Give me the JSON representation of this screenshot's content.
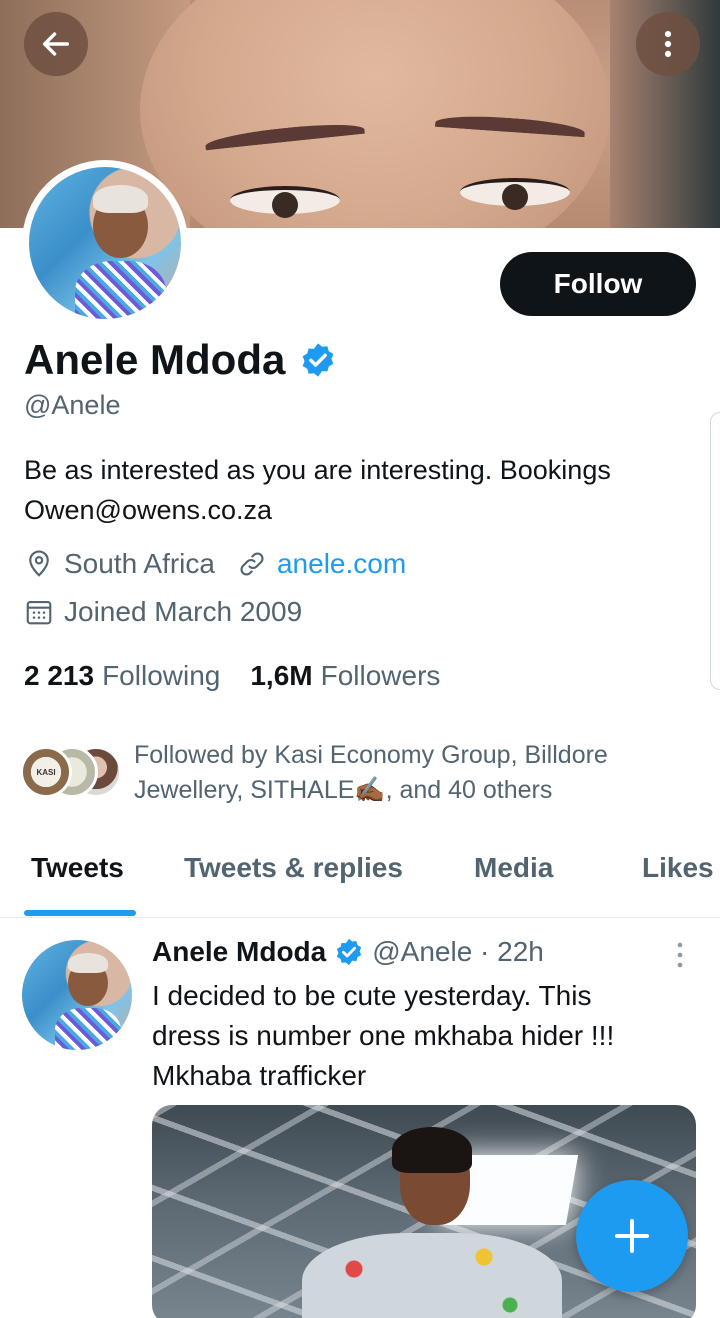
{
  "header": {
    "back_icon": "arrow-left-icon",
    "more_icon": "more-vertical-icon"
  },
  "profile": {
    "name": "Anele Mdoda",
    "handle": "@Anele",
    "follow_label": "Follow",
    "bio_lines": [
      "Be as interested as you are interesting. Bookings",
      "Owen@owens.co.za"
    ],
    "location": "South Africa",
    "website": "anele.com",
    "joined": "Joined March 2009",
    "following_count": "2 213",
    "following_label": "Following",
    "followers_count": "1,6M",
    "followers_label": "Followers",
    "followed_by_lines": [
      "Followed by Kasi Economy Group, Billdore",
      "Jewellery, SITHALE✍🏾, and 40 others"
    ],
    "followed_by_avatar_text": "KASI"
  },
  "tabs": [
    {
      "label": "Tweets",
      "active": true
    },
    {
      "label": "Tweets & replies",
      "active": false
    },
    {
      "label": "Media",
      "active": false
    },
    {
      "label": "Likes",
      "active": false
    }
  ],
  "tweet": {
    "name": "Anele Mdoda",
    "meta": "@Anele · 22h",
    "text_lines": [
      "I decided to be cute yesterday. This",
      "dress is number one mkhaba hider !!!",
      "Mkhaba trafficker"
    ]
  },
  "fab": {
    "icon": "plus-icon"
  },
  "colors": {
    "accent": "#1d9bf0",
    "text": "#0f1419",
    "secondary": "#536471"
  }
}
